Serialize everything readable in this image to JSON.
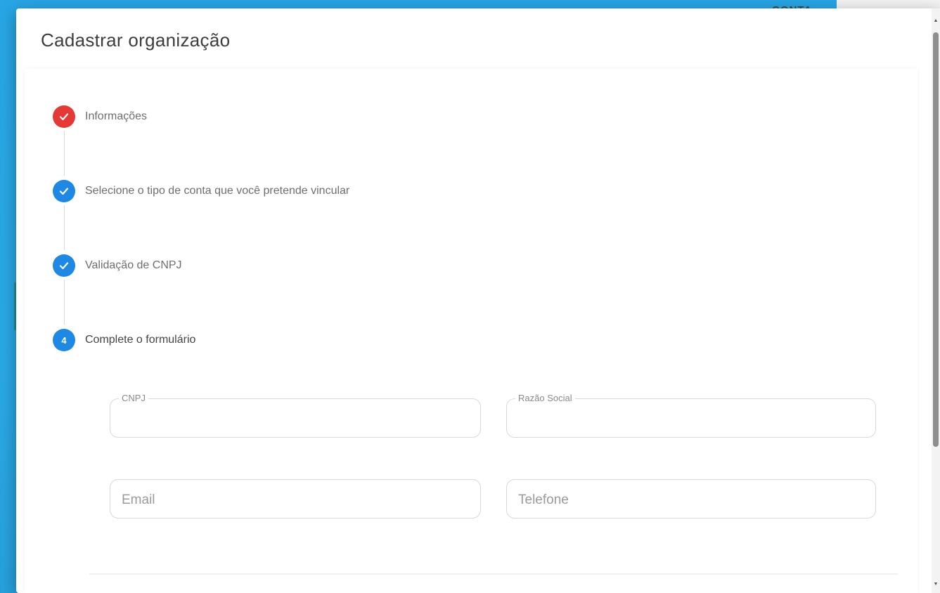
{
  "background": {
    "header_text": "CONTA"
  },
  "modal": {
    "title": "Cadastrar organização"
  },
  "stepper": {
    "steps": [
      {
        "label": "Informações",
        "state": "completed",
        "color": "#e53935",
        "icon": "check-icon"
      },
      {
        "label": "Selecione o tipo de conta que você pretende vincular",
        "state": "completed",
        "color": "#1e88e5",
        "icon": "check-icon"
      },
      {
        "label": "Validação de CNPJ",
        "state": "completed",
        "color": "#1e88e5",
        "icon": "check-icon"
      },
      {
        "label": "Complete o formulário",
        "state": "active",
        "number": "4",
        "color": "#1e88e5"
      }
    ]
  },
  "form": {
    "cnpj": {
      "label": "CNPJ",
      "value": ""
    },
    "razao_social": {
      "label": "Razão Social",
      "value": ""
    },
    "email": {
      "placeholder": "Email",
      "value": ""
    },
    "telefone": {
      "placeholder": "Telefone",
      "value": ""
    }
  },
  "colors": {
    "background": "#27a6e5",
    "accent": "#1e88e5",
    "completed_first": "#e53935"
  }
}
